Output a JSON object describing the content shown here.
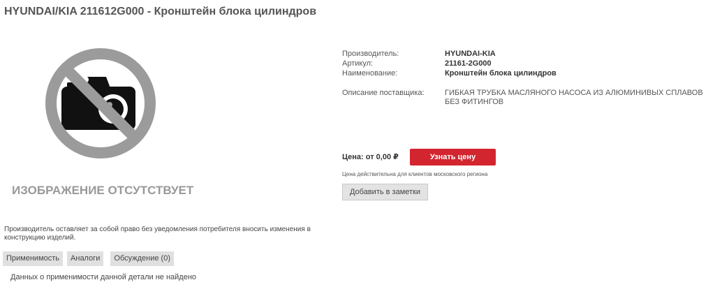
{
  "product": {
    "title": "HYUNDAI/KIA 211612G000 - Кронштейн блока цилиндров",
    "image_missing_text": "ИЗОБРАЖЕНИЕ ОТСУТСТВУЕТ",
    "disclaimer": "Производитель оставляет за собой право без уведомления потребителя вносить изменения в конструкцию изделий."
  },
  "details": {
    "manufacturer_label": "Производитель:",
    "manufacturer_value": "HYUNDAI-KIA",
    "article_label": "Артикул:",
    "article_value": "21161-2G000",
    "name_label": "Наименование:",
    "name_value": "Кронштейн блока цилиндров",
    "supplier_desc_label": "Описание поставщика:",
    "supplier_desc_value": "ГИБКАЯ ТРУБКА МАСЛЯНОГО НАСОСА ИЗ АЛЮМИНИВЫХ СПЛАВОВ БЕЗ ФИТИНГОВ"
  },
  "pricing": {
    "price_text": "Цена: от 0,00 ₽",
    "get_price_label": "Узнать цену",
    "price_note": "Цена действительна для клиентов московского региона",
    "add_to_notes_label": "Добавить в заметки"
  },
  "tabs": [
    {
      "label": "Применимость"
    },
    {
      "label": "Аналоги"
    },
    {
      "label": "Обсуждение (0)"
    }
  ],
  "applicability": {
    "empty_text": "Данных о применимости данной детали не найдено"
  },
  "icons": {
    "no_image": "no-camera-icon"
  },
  "colors": {
    "accent": "#d3252f",
    "no_image_gray": "#999999"
  }
}
